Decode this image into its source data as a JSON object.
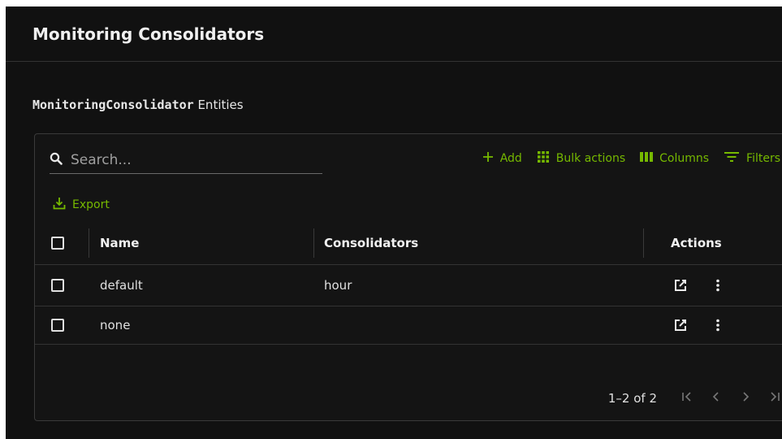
{
  "header": {
    "title": "Monitoring Consolidators"
  },
  "subtitle": {
    "entity": "MonitoringConsolidator",
    "suffix": " Entities"
  },
  "search": {
    "placeholder": "Search...",
    "value": ""
  },
  "toolbar": {
    "add_label": "Add",
    "bulk_label": "Bulk actions",
    "columns_label": "Columns",
    "filters_label": "Filters",
    "export_label": "Export"
  },
  "table": {
    "columns": [
      "Name",
      "Consolidators",
      "Actions"
    ],
    "rows": [
      {
        "name": "default",
        "consolidators": "hour"
      },
      {
        "name": "none",
        "consolidators": ""
      }
    ]
  },
  "pagination": {
    "range": "1–2 of 2"
  },
  "colors": {
    "accent": "#76b900",
    "background": "#111111",
    "border": "#333333"
  }
}
